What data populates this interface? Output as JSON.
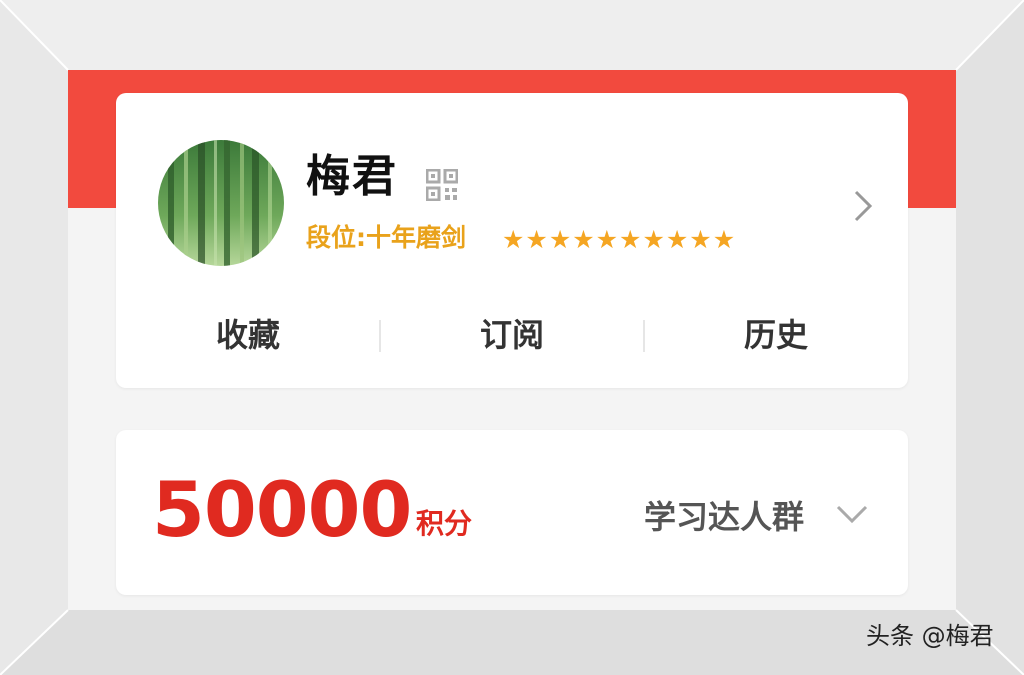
{
  "profile": {
    "name": "梅君",
    "rank_label": "段位:十年磨剑",
    "stars": "★★★★★★★★★★",
    "star_count": 10,
    "qr_icon": "qr-code-icon",
    "chevron_icon": "chevron-right-icon"
  },
  "tabs": [
    "收藏",
    "订阅",
    "历史"
  ],
  "points": {
    "value": "50000",
    "unit": "积分",
    "group_label": "学习达人群",
    "dropdown_icon": "chevron-down-icon"
  },
  "watermark": "头条 @梅君",
  "colors": {
    "header_red": "#f24a3e",
    "points_red": "#e02a20",
    "rank_gold": "#e9a21b",
    "star_gold": "#f5a623"
  }
}
